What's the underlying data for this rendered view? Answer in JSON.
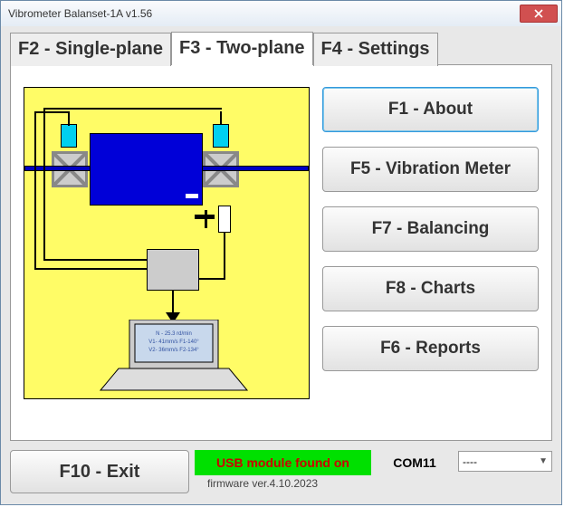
{
  "window": {
    "title": "Vibrometer Balanset-1A  v1.56"
  },
  "tabs": [
    {
      "label": "F2 - Single-plane",
      "active": false
    },
    {
      "label": "F3 - Two-plane",
      "active": true
    },
    {
      "label": "F4 - Settings",
      "active": false
    }
  ],
  "side_buttons": {
    "about": "F1 - About",
    "vibmeter": "F5 - Vibration Meter",
    "balancing": "F7 - Balancing",
    "charts": "F8 - Charts",
    "reports": "F6 - Reports"
  },
  "exit_label": "F10 - Exit",
  "status": {
    "text": "USB module found on",
    "com": "COM11",
    "combo_value": "----"
  },
  "firmware": "firmware ver.4.10.2023"
}
